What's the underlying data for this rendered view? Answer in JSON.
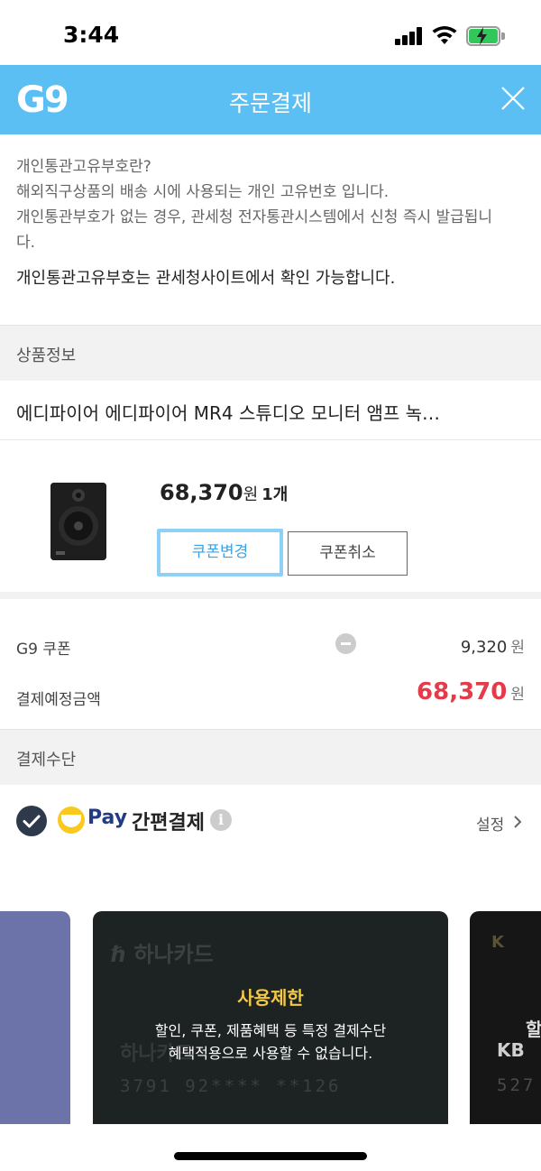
{
  "status_bar": {
    "time": "3:44"
  },
  "header": {
    "logo": "G9",
    "title": "주문결제"
  },
  "info": {
    "line1": "개인통관고유부호란?",
    "line2": "해외직구상품의 배송 시에 사용되는 개인 고유번호 입니다.",
    "line3": "개인통관부호가 없는 경우, 관세청 전자통관시스템에서 신청 즉시 발급됩니",
    "line4": "다.",
    "emphasis": "개인통관고유부호는 관세청사이트에서 확인 가능합니다."
  },
  "product_section": {
    "heading": "상품정보",
    "name": "에디파이어 에디파이어 MR4 스튜디오 모니터 앰프 녹…",
    "price": "68,370",
    "price_unit": "원",
    "quantity": "1개",
    "coupon_change_label": "쿠폰변경",
    "coupon_cancel_label": "쿠폰취소"
  },
  "summary": {
    "coupon_label": "G9 쿠폰",
    "coupon_value": "9,320",
    "coupon_unit": "원",
    "total_label": "결제예정금액",
    "total_value": "68,370",
    "total_unit": "원"
  },
  "payment": {
    "heading": "결제수단",
    "brand": "Pay",
    "method_label": "간편결제",
    "settings_label": "설정",
    "selected": true
  },
  "cards": {
    "main_brand": "하나카드",
    "main_brand_sub": "하나카드",
    "main_number": "3791 92**** **126",
    "restriction_title": "사용제한",
    "restriction_msg_line1": "할인, 쿠폰, 제품혜택 등 특정 결제수단",
    "restriction_msg_line2": "혜택적용으로 사용할 수 없습니다.",
    "right_logo": "K",
    "right_label_partial": "KB",
    "right_text_partial": "할",
    "right_number_partial": "527"
  },
  "colors": {
    "header_bg": "#5bbff4",
    "total_red": "#e43b4a",
    "restriction_yellow": "#f3c944",
    "check_navy": "#2e3a4c"
  }
}
